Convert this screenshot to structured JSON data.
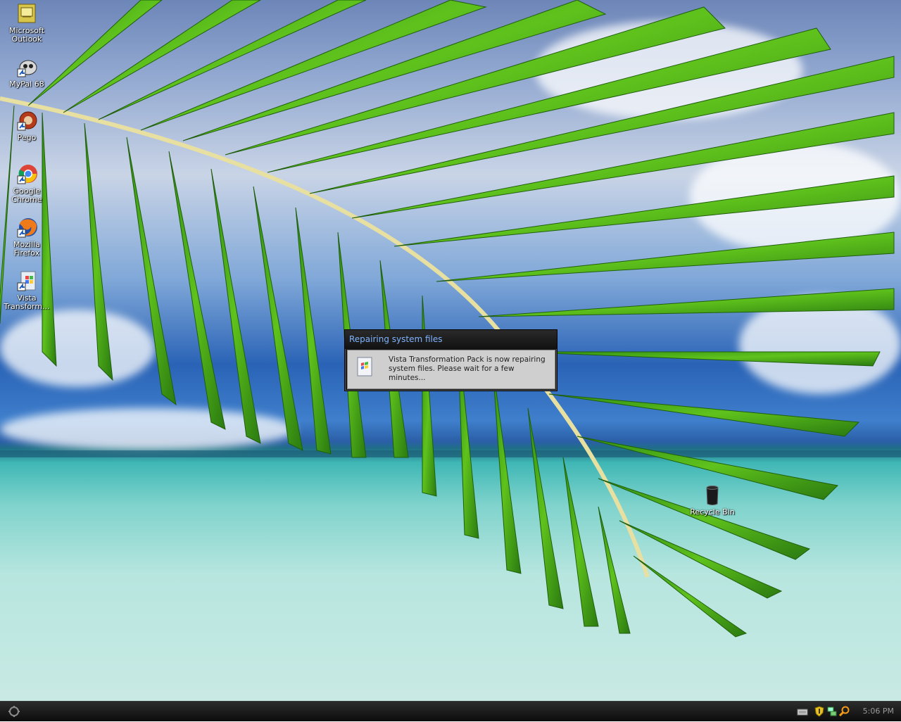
{
  "desktop": {
    "icons": [
      {
        "label": "Microsoft Outlook",
        "icon": "outlook-icon"
      },
      {
        "label": "MyPal 68",
        "icon": "mypal-icon"
      },
      {
        "label": "Pego",
        "icon": "pego-icon"
      },
      {
        "label": "Google Chrome",
        "icon": "chrome-icon"
      },
      {
        "label": "Mozilla Firefox",
        "icon": "firefox-icon"
      },
      {
        "label": "Vista Transform...",
        "icon": "vista-transformation-icon"
      }
    ],
    "recycle_bin": {
      "label": "Recycle Bin",
      "icon": "recycle-bin-icon"
    }
  },
  "dialog": {
    "title": "Repairing system files",
    "message": "Vista Transformation Pack is now repairing system files. Please wait for a few minutes...",
    "icon": "windows-setup-icon"
  },
  "taskbar": {
    "start_icon": "start-orb-icon",
    "tray_icons": [
      "keyboard-icon",
      "shield-icon",
      "network-icon",
      "search-icon"
    ],
    "clock": "5:06 PM"
  },
  "colors": {
    "dialog_title": "#7fb4ff",
    "taskbar": "#1a1a1a"
  }
}
